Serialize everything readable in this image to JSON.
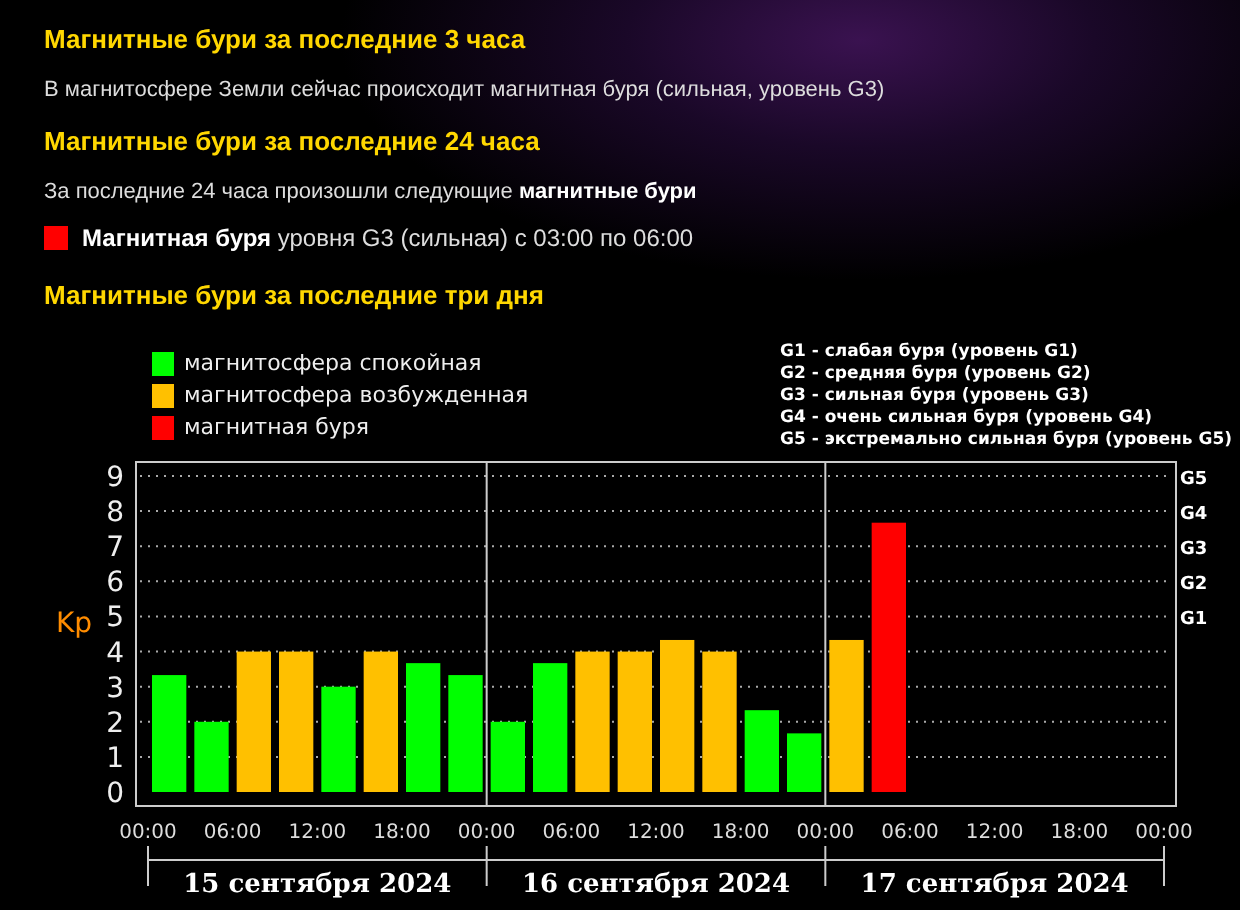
{
  "sections": [
    {
      "title": "Магнитные бури за последние 3 часа",
      "text": "В магнитосфере Земли сейчас происходит магнитная буря (сильная, уровень G3)"
    },
    {
      "title": "Магнитные бури за последние 24 часа",
      "text": "За последние 24 часа произошли следующие **магнитные бури**",
      "events": [
        {
          "color": "#ff0000",
          "text": "**Магнитная буря** уровня G3 (сильная) с 03:00 по 06:00"
        }
      ]
    },
    {
      "title": "Магнитные бури за последние три дня",
      "chart": {
        "g_legend": [
          "G1 - слабая буря (уровень G1)",
          "G2 - средняя буря (уровень G2)",
          "G3 - сильная буря (уровень G3)",
          "G4 - очень сильная буря (уровень G4)",
          "G5 - экстремально сильная буря (уровень G5)"
        ],
        "g_scale": [
          "G5",
          "G4",
          "G3",
          "G2",
          "G1"
        ],
        "days": [
          "15 сентября 2024",
          "16 сентября 2024",
          "17 сентября 2024"
        ],
        "time_labels": [
          "00:00",
          "06:00",
          "12:00",
          "18:00",
          "00:00",
          "06:00",
          "12:00",
          "18:00",
          "00:00",
          "06:00",
          "12:00",
          "18:00",
          "00:00"
        ],
        "chart_data": {
          "type": "bar",
          "ylabel": "Kp",
          "ylim": [
            0,
            9
          ],
          "yticks": [
            0,
            1,
            2,
            3,
            4,
            5,
            6,
            7,
            8,
            9
          ],
          "stacked": true,
          "grid": true,
          "series": [
            {
              "name": "магнитосфера спокойная",
              "color": "#00ff00",
              "values": [
                3.33,
                2,
                null,
                null,
                3,
                null,
                3.67,
                3.33,
                2,
                3.67,
                null,
                null,
                null,
                null,
                2.33,
                1.67,
                null,
                null,
                null,
                null,
                null,
                null,
                null,
                null
              ]
            },
            {
              "name": "магнитосфера возбужденная",
              "color": "#ffc000",
              "values": [
                null,
                null,
                4,
                4,
                null,
                4,
                null,
                null,
                null,
                null,
                4,
                4,
                4.33,
                4,
                null,
                null,
                4.33,
                null,
                null,
                null,
                null,
                null,
                null,
                null
              ]
            },
            {
              "name": "магнитная буря",
              "color": "#ff0000",
              "values": [
                null,
                null,
                null,
                null,
                null,
                null,
                null,
                null,
                null,
                null,
                null,
                null,
                null,
                null,
                null,
                null,
                null,
                7.67,
                null,
                null,
                null,
                null,
                null,
                null
              ]
            }
          ]
        }
      }
    }
  ]
}
